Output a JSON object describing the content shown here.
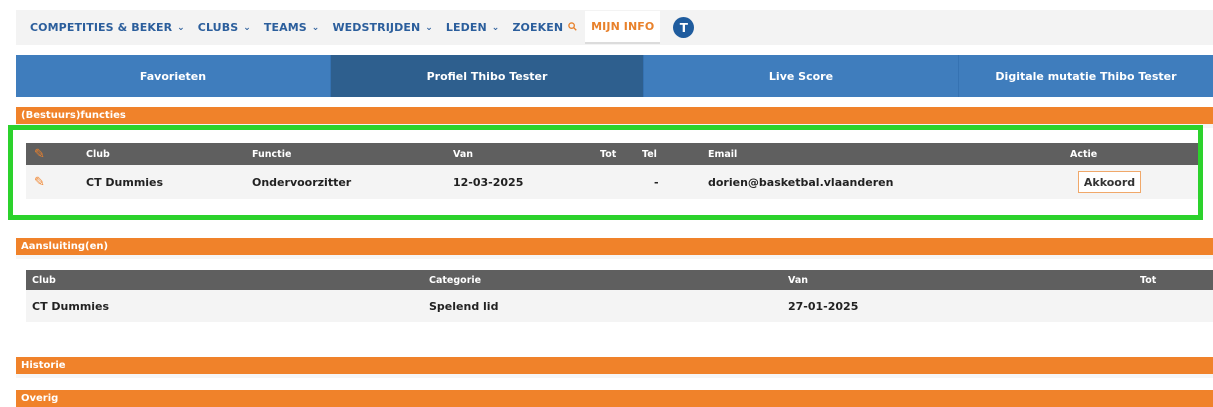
{
  "nav": {
    "items": [
      {
        "label": "COMPETITIES & BEKER",
        "caret": "⌄"
      },
      {
        "label": "CLUBS",
        "caret": "⌄"
      },
      {
        "label": "TEAMS",
        "caret": "⌄"
      },
      {
        "label": "WEDSTRIJDEN",
        "caret": "⌄"
      },
      {
        "label": "LEDEN",
        "caret": "⌄"
      }
    ],
    "search_label": "ZOEKEN",
    "search_icon": "search-icon",
    "mijn_info_label": "MIJN INFO",
    "avatar_letter": "T"
  },
  "tabs": [
    {
      "label": "Favorieten"
    },
    {
      "label": "Profiel Thibo Tester"
    },
    {
      "label": "Live Score"
    },
    {
      "label": "Digitale mutatie Thibo Tester"
    }
  ],
  "functies": {
    "title": "(Bestuurs)functies",
    "headers": {
      "club": "Club",
      "functie": "Functie",
      "van": "Van",
      "tot": "Tot",
      "tel": "Tel",
      "email": "Email",
      "actie": "Actie"
    },
    "rows": [
      {
        "club": "CT Dummies",
        "functie": "Ondervoorzitter",
        "van": "12-03-2025",
        "tot": "",
        "tel": "-",
        "email": "dorien@basketbal.vlaanderen",
        "actie": "Akkoord"
      }
    ]
  },
  "aansluiting": {
    "title": "Aansluiting(en)",
    "headers": {
      "club": "Club",
      "categorie": "Categorie",
      "van": "Van",
      "tot": "Tot"
    },
    "rows": [
      {
        "club": "CT Dummies",
        "categorie": "Spelend lid",
        "van": "27-01-2025",
        "tot": ""
      }
    ]
  },
  "historie": {
    "title": "Historie"
  },
  "overig": {
    "title": "Overig"
  },
  "colors": {
    "accent_orange": "#f0822a",
    "nav_blue": "#2b5e9c",
    "tab_blue": "#3f7dbd",
    "tab_active": "#2e5f8e",
    "highlight_green": "#2cd22c"
  }
}
